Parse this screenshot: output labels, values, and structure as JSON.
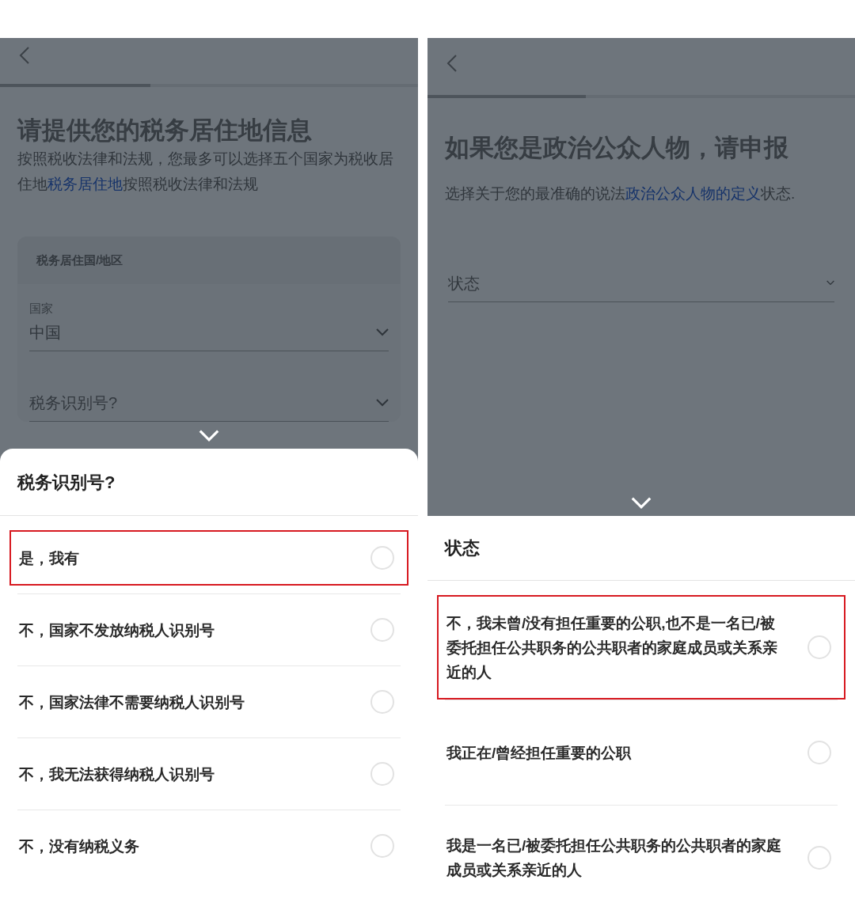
{
  "panels": [
    {
      "progress": {
        "level": 0.36
      },
      "title": "请提供您的税务居住地信息",
      "description": [
        {
          "kind": "text",
          "text": "按照税收法律和法规，您最多可以选择五个国家为税收居住地"
        },
        {
          "kind": "link",
          "text": "税务居住地"
        },
        {
          "kind": "text",
          "text": "按照税收法律和法规"
        }
      ],
      "form": {
        "section_title": "税务居住国/地区",
        "fields": [
          {
            "label": "国家",
            "value": "中国"
          },
          {
            "placeholder": "税务识别号?"
          }
        ]
      },
      "sheet": {
        "title": "税务识别号?",
        "options": [
          {
            "label": "是，我有",
            "selected": false,
            "highlighted": true
          },
          {
            "label": "不，国家不发放纳税人识别号",
            "selected": false,
            "highlighted": false
          },
          {
            "label": "不，国家法律不需要纳税人识别号",
            "selected": false,
            "highlighted": false
          },
          {
            "label": "不，我无法获得纳税人识别号",
            "selected": false,
            "highlighted": false
          },
          {
            "label": "不，没有纳税义务",
            "selected": false,
            "highlighted": false
          }
        ]
      }
    },
    {
      "progress": {
        "level": 0.37
      },
      "title": "如果您是政治公众人物，请申报",
      "description": [
        {
          "kind": "text",
          "text": "选择关于您的最准确的说法"
        },
        {
          "kind": "link",
          "text": "政治公众人物的定义"
        },
        {
          "kind": "text",
          "text": "状态."
        }
      ],
      "form": {
        "fields": [
          {
            "placeholder": "状态"
          }
        ]
      },
      "sheet": {
        "title": "状态",
        "options": [
          {
            "label": "不，我未曾/没有担任重要的公职,也不是一名已/被委托担任公共职务的公共职者的家庭成员或关系亲近的人",
            "selected": false,
            "highlighted": true
          },
          {
            "label": "我正在/曾经担任重要的公职",
            "selected": false,
            "highlighted": false
          },
          {
            "label": "我是一名已/被委托担任公共职务的公共职者的家庭成员或关系亲近的人",
            "selected": false,
            "highlighted": false
          }
        ]
      }
    }
  ]
}
